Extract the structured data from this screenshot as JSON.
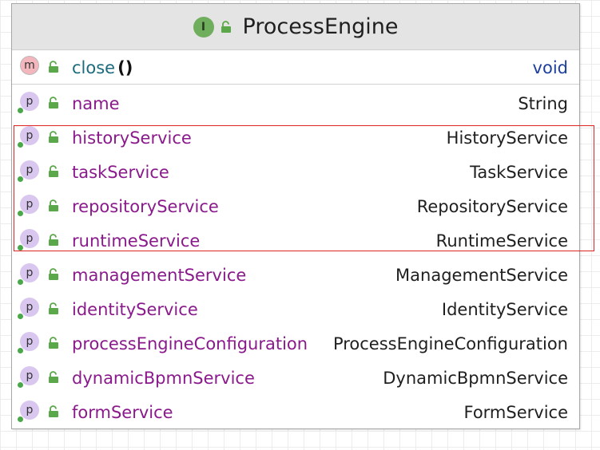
{
  "class_box": {
    "title": "ProcessEngine",
    "stereotype_icon_letter": "I",
    "icons": {
      "stereotype": "interface-icon",
      "visibility": "lock-icon"
    },
    "colors": {
      "header_bg": "#e4e4e4",
      "member_name": "#8a1a8c",
      "method_name": "#1c6b7e",
      "return_type": "#1d3f9e",
      "highlight": "#e02424",
      "visibility_green": "#5aa84a"
    }
  },
  "methods": [
    {
      "badge": "m",
      "name": "close",
      "params": "()",
      "return_type": "void"
    }
  ],
  "properties": [
    {
      "badge": "p",
      "name": "name",
      "type": "String"
    },
    {
      "badge": "p",
      "name": "historyService",
      "type": "HistoryService"
    },
    {
      "badge": "p",
      "name": "taskService",
      "type": "TaskService"
    },
    {
      "badge": "p",
      "name": "repositoryService",
      "type": "RepositoryService"
    },
    {
      "badge": "p",
      "name": "runtimeService",
      "type": "RuntimeService"
    },
    {
      "badge": "p",
      "name": "managementService",
      "type": "ManagementService"
    },
    {
      "badge": "p",
      "name": "identityService",
      "type": "IdentityService"
    },
    {
      "badge": "p",
      "name": "processEngineConfiguration",
      "type": "ProcessEngineConfiguration"
    },
    {
      "badge": "p",
      "name": "dynamicBpmnService",
      "type": "DynamicBpmnService"
    },
    {
      "badge": "p",
      "name": "formService",
      "type": "FormService"
    }
  ]
}
